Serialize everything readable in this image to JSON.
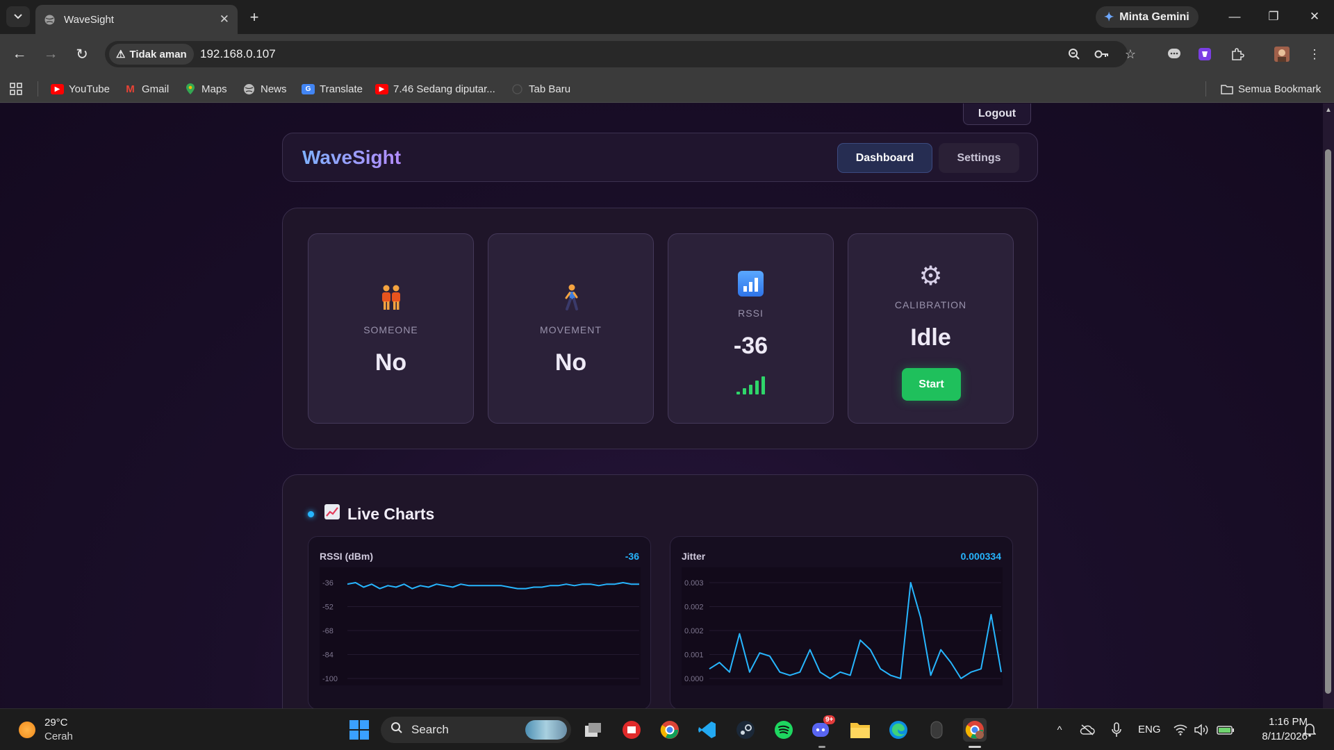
{
  "browser": {
    "tab_title": "WaveSight",
    "gemini_label": "Minta Gemini",
    "security_label": "Tidak aman",
    "url": "192.168.0.107",
    "bookmarks": [
      {
        "label": "YouTube",
        "icon": "youtube-icon",
        "color": "#ff0000"
      },
      {
        "label": "Gmail",
        "icon": "gmail-icon",
        "color": "#ea4335"
      },
      {
        "label": "Maps",
        "icon": "maps-icon",
        "color": "#34a853"
      },
      {
        "label": "News",
        "icon": "news-icon",
        "color": "#bdbdbd"
      },
      {
        "label": "Translate",
        "icon": "translate-icon",
        "color": "#4285f4"
      },
      {
        "label": "7.46 Sedang diputar...",
        "icon": "youtube-icon",
        "color": "#ff0000"
      },
      {
        "label": "Tab Baru",
        "icon": "globe-icon",
        "color": "#555555"
      }
    ],
    "all_bookmarks_label": "Semua Bookmark"
  },
  "app": {
    "logout_label": "Logout",
    "brand": "WaveSight",
    "nav": {
      "dashboard": "Dashboard",
      "settings": "Settings",
      "active": "Dashboard"
    },
    "stats": {
      "someone": {
        "label": "SOMEONE",
        "value": "No",
        "icon": "people-icon"
      },
      "movement": {
        "label": "MOVEMENT",
        "value": "No",
        "icon": "walking-person-icon"
      },
      "rssi": {
        "label": "RSSI",
        "value": "-36",
        "icon": "bar-chart-icon",
        "signal_level": 5
      },
      "calibration": {
        "label": "CALIBRATION",
        "value": "Idle",
        "icon": "gear-icon",
        "button_label": "Start"
      }
    },
    "charts_title": "Live Charts",
    "colors": {
      "accent": "#27b6ff",
      "success": "#1fc05c",
      "brand_from": "#7fb1ff",
      "brand_to": "#b48cff"
    }
  },
  "chart_data": [
    {
      "type": "line",
      "title": "RSSI (dBm)",
      "current_value": "-36",
      "ylim": [
        -100,
        -36
      ],
      "yticks": [
        "-36",
        "-52",
        "-68",
        "-84",
        "-100"
      ],
      "values": [
        -37,
        -36,
        -39,
        -37,
        -40,
        -38,
        -39,
        -37,
        -40,
        -38,
        -39,
        -37,
        -38,
        -39,
        -37,
        -38,
        -38,
        -38,
        -38,
        -38,
        -39,
        -40,
        -40,
        -39,
        -39,
        -38,
        -38,
        -37,
        -38,
        -37,
        -37,
        -38,
        -37,
        -37,
        -36,
        -37,
        -37
      ],
      "color": "#27b6ff"
    },
    {
      "type": "line",
      "title": "Jitter",
      "current_value": "0.000334",
      "ylim": [
        0.0,
        0.003
      ],
      "yticks": [
        "0.003",
        "0.002",
        "0.002",
        "0.001",
        "0.000"
      ],
      "values": [
        0.0003,
        0.0005,
        0.0002,
        0.0014,
        0.0002,
        0.0008,
        0.0007,
        0.0002,
        0.0001,
        0.0002,
        0.0009,
        0.0002,
        0.0,
        0.0002,
        0.0001,
        0.0012,
        0.0009,
        0.0003,
        0.0001,
        0.0,
        0.003,
        0.0019,
        0.0001,
        0.0009,
        0.0005,
        0.0,
        0.0002,
        0.0003,
        0.002,
        0.0002
      ],
      "color": "#27b6ff"
    }
  ],
  "taskbar": {
    "weather_temp": "29°C",
    "weather_desc": "Cerah",
    "search_label": "Search",
    "lang": "ENG",
    "time": "1:16 PM",
    "date": "8/11/2026",
    "discord_badge": "9+"
  }
}
